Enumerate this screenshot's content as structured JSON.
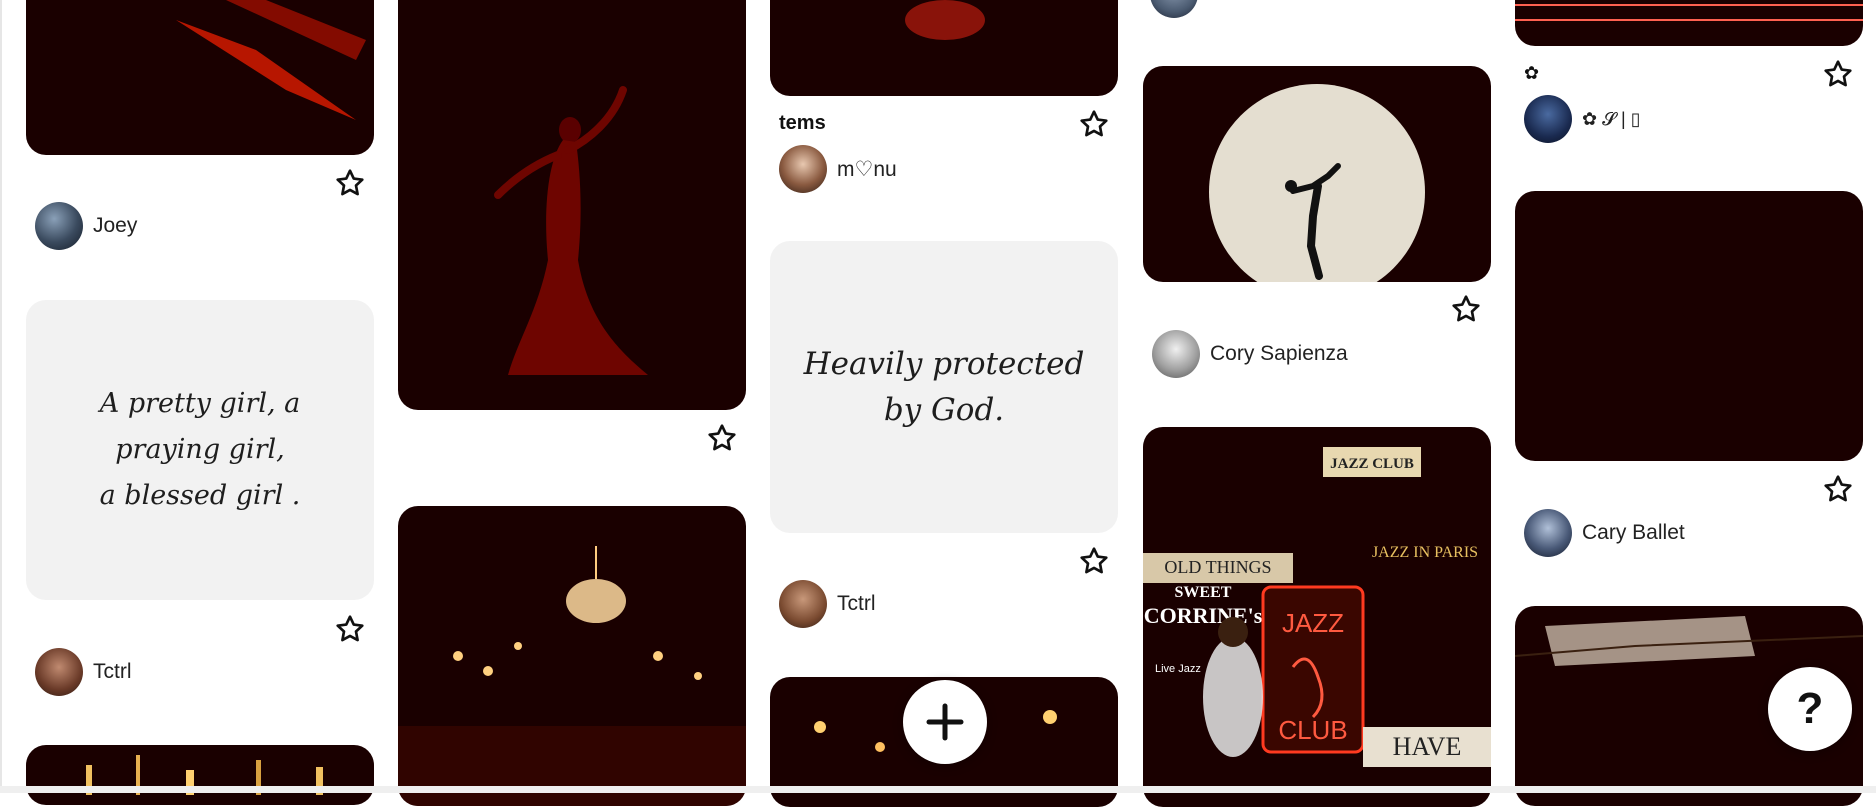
{
  "pins": {
    "col1_top": {
      "user": "Joey"
    },
    "col1_quote": {
      "quote_line1": "A pretty girl, a praying girl,",
      "quote_line2": "a blessed girl .",
      "user": "Tctrl"
    },
    "col3_top": {
      "title": "tems",
      "user": "m♡nu"
    },
    "col3_quote": {
      "quote": "Heavily protected by God.",
      "user": "Tctrl"
    },
    "col4_moon": {
      "user": "Cory Sapienza"
    },
    "col5_top": {
      "title": "✿",
      "user": "✿ 𝓢 | ▯"
    },
    "col5_stage": {
      "user": "Cary Ballet"
    }
  },
  "collage_text": {
    "jazz_club": "JAZZ CLUB",
    "old_things": "OLD THINGS",
    "sweet": "SWEET",
    "corrines": "CORRINE's",
    "neon_jazz": "JAZZ",
    "neon_club": "CLUB",
    "jazz_in_paris": "JAZZ IN PARIS",
    "have": "HAVE",
    "live_jazz": "Live Jazz"
  },
  "actions": {
    "create_symbol": "+",
    "help_symbol": "?"
  },
  "icons": {
    "save": "star-outline-icon",
    "create": "plus-icon",
    "help": "question-icon"
  },
  "colors": {
    "accent": "#e60023",
    "card_bg": "#f2f2f2"
  }
}
